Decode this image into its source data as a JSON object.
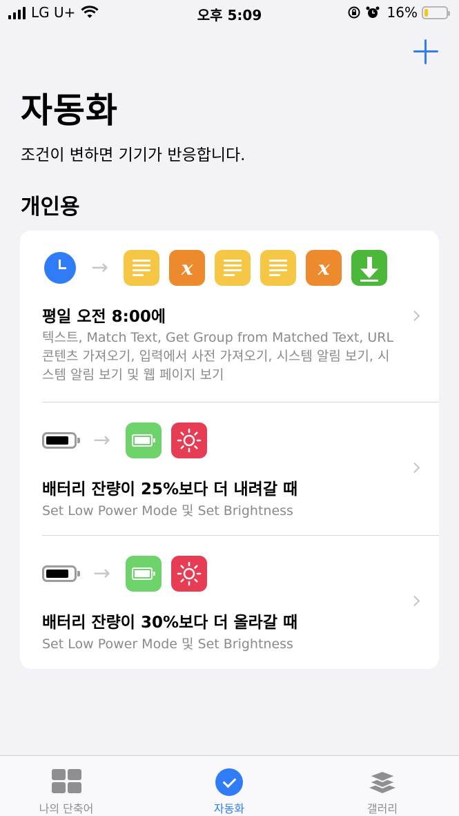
{
  "status_bar": {
    "carrier": "LG U+",
    "time": "오후 5:09",
    "battery_percent": "16%",
    "battery_level": 0.16
  },
  "header": {
    "add_icon": "plus-icon",
    "title": "자동화",
    "subtitle": "조건이 변하면 기기가 반응합니다."
  },
  "section": {
    "title": "개인용"
  },
  "automations": [
    {
      "trigger_icon": "clock-icon",
      "actions": [
        "text-icon",
        "variable-icon",
        "text-icon",
        "text-icon",
        "variable-icon",
        "download-icon"
      ],
      "title": "평일 오전 8:00에",
      "description": "텍스트, Match Text, Get Group from Matched Text, URL 콘텐츠 가져오기, 입력에서 사전 가져오기, 시스템 알림 보기, 시스템 알림 보기 및 웹 페이지 보기"
    },
    {
      "trigger_icon": "battery-icon",
      "actions": [
        "low-power-icon",
        "brightness-icon"
      ],
      "title": "배터리 잔량이 25%보다 더 내려갈 때",
      "description": "Set Low Power Mode 및 Set Brightness"
    },
    {
      "trigger_icon": "battery-icon",
      "actions": [
        "low-power-icon",
        "brightness-icon"
      ],
      "title": "배터리 잔량이 30%보다 더 올라갈 때",
      "description": "Set Low Power Mode 및 Set Brightness"
    }
  ],
  "tab_bar": {
    "tabs": [
      {
        "label": "나의 단축어",
        "icon": "grid-icon",
        "active": false
      },
      {
        "label": "자동화",
        "icon": "checkmark-circle-icon",
        "active": true
      },
      {
        "label": "갤러리",
        "icon": "layers-icon",
        "active": false
      }
    ]
  },
  "colors": {
    "accent": "#2f7cf6",
    "text_action": "#f6c745",
    "variable_action": "#ee8a2e",
    "download_action": "#4cb83a",
    "low_power_action": "#6dd36a",
    "brightness_action": "#e63d55"
  }
}
